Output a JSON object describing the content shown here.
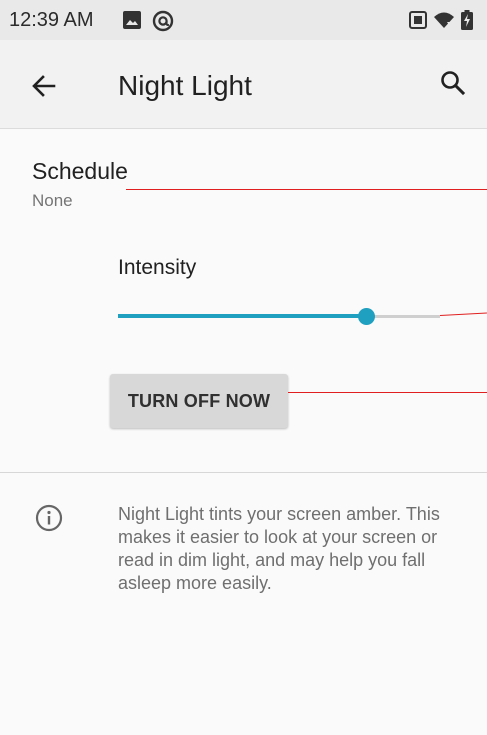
{
  "status_bar": {
    "time": "12:39 AM",
    "left_icons": [
      "image-icon",
      "at-sign-icon"
    ],
    "right_icons": [
      "vibrate-icon",
      "wifi-icon",
      "battery-charging-icon"
    ]
  },
  "app_bar": {
    "title": "Night Light",
    "back_icon": "arrow-back-icon",
    "search_icon": "search-icon"
  },
  "schedule": {
    "title": "Schedule",
    "summary": "None"
  },
  "intensity": {
    "label": "Intensity",
    "value_fraction": 0.77
  },
  "turn_off_button": {
    "label": "TURN OFF NOW"
  },
  "footer": {
    "icon": "info-icon",
    "text": "Night Light tints your screen amber. This makes it easier to look at your screen or read in dim light, and may help you fall asleep more easily."
  },
  "colors": {
    "accent": "#1fa0c0",
    "annotation_line": "#e02020",
    "status_bar_bg": "#e9e9e9"
  }
}
